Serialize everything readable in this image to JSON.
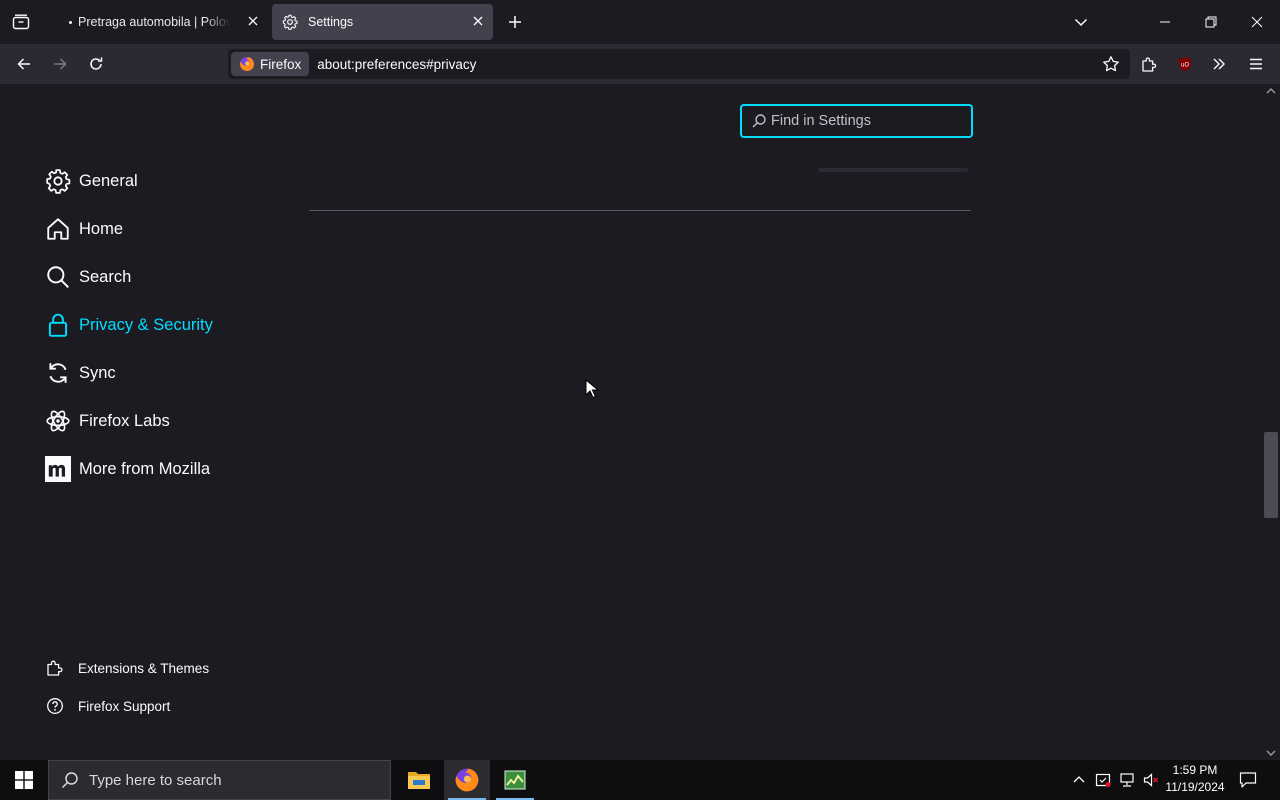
{
  "browser": {
    "tabs": [
      {
        "title": "Pretraga automobila | Polovni automobili",
        "active": false,
        "attention_dot": true
      },
      {
        "title": "Settings",
        "active": true,
        "icon": "gear-icon"
      }
    ],
    "url": {
      "identity_label": "Firefox",
      "address": "about:preferences#privacy"
    },
    "toolbar_icons": [
      "back-icon",
      "forward-icon",
      "reload-icon",
      "bookmark-star-icon",
      "extensions-icon",
      "ublock-origin-icon",
      "overflow-chevrons-icon",
      "hamburger-menu-icon"
    ]
  },
  "settings": {
    "search": {
      "placeholder": "Find in Settings",
      "value": ""
    },
    "categories": [
      {
        "label": "General",
        "icon": "gear-icon"
      },
      {
        "label": "Home",
        "icon": "home-icon"
      },
      {
        "label": "Search",
        "icon": "magnifier-icon"
      },
      {
        "label": "Privacy & Security",
        "icon": "lock-icon",
        "selected": true
      },
      {
        "label": "Sync",
        "icon": "sync-icon"
      },
      {
        "label": "Firefox Labs",
        "icon": "atom-icon"
      },
      {
        "label": "More from Mozilla",
        "icon": "mozilla-m-icon"
      }
    ],
    "footer_links": [
      {
        "label": "Extensions & Themes",
        "icon": "puzzle-icon"
      },
      {
        "label": "Firefox Support",
        "icon": "help-circle-icon"
      }
    ]
  },
  "taskbar": {
    "search_placeholder": "Type here to search",
    "pinned_apps": [
      "file-explorer-icon",
      "firefox-icon",
      "resource-monitor-icon"
    ],
    "clock": {
      "time": "1:59 PM",
      "date": "11/19/2024"
    }
  },
  "colors": {
    "accent": "#00ddff",
    "background": "#1c1b22",
    "toolbar": "#2b2a33",
    "active_tab": "#42414d"
  }
}
